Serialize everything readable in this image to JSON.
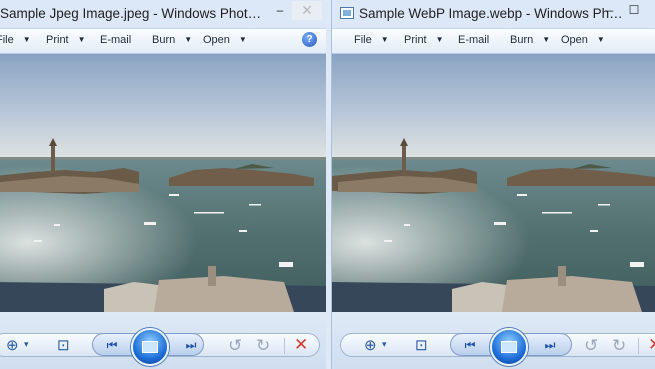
{
  "windows": [
    {
      "title": "Sample Jpeg Image.jpeg - Windows Phot…",
      "menu": [
        {
          "label": "File"
        },
        {
          "label": "Print"
        },
        {
          "label": "E-mail"
        },
        {
          "label": "Burn"
        },
        {
          "label": "Open"
        }
      ],
      "caption_buttons": {
        "minimize": "–",
        "maximize": "☐",
        "close": "✕"
      }
    },
    {
      "title": "Sample WebP Image.webp - Windows Ph…",
      "menu": [
        {
          "label": "File"
        },
        {
          "label": "Print"
        },
        {
          "label": "E-mail"
        },
        {
          "label": "Burn"
        },
        {
          "label": "Open"
        }
      ],
      "caption_buttons": {
        "minimize": "–",
        "maximize": "☐"
      }
    }
  ],
  "help_glyph": "?",
  "controls": {
    "zoom": "⊕",
    "zoom_caret": "▾",
    "actual_size": "⊡",
    "previous": "⏮",
    "next": "⏭",
    "rotate_ccw": "↺",
    "rotate_cw": "↻",
    "delete": "✕"
  },
  "colors": {
    "sky_top": "#8fa7c6",
    "sky_bottom": "#dfe6ea",
    "water": "#4e6b6e",
    "land": "#6a5a48",
    "delete_red": "#d03a2e",
    "accent_blue": "#2b5aa6"
  }
}
